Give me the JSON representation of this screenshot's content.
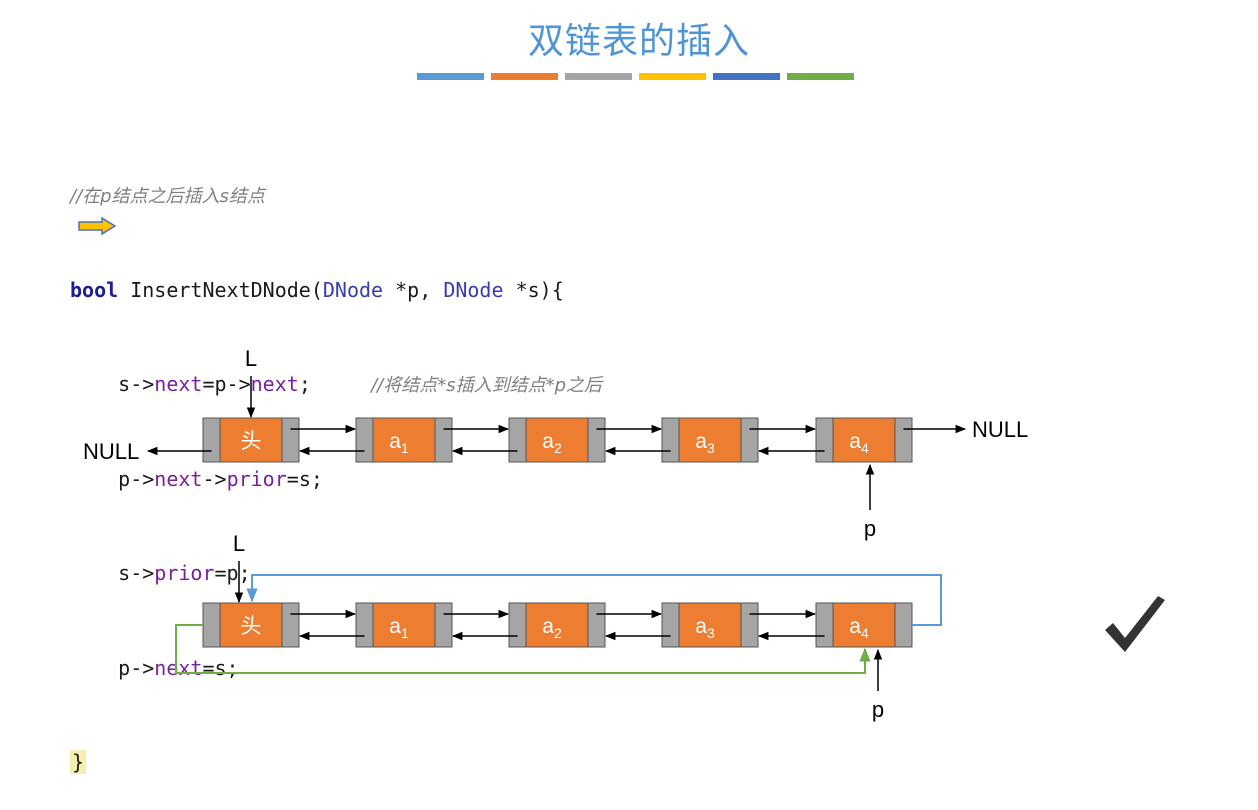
{
  "title": "双链表的插入",
  "colors": {
    "title": "#4f95d6",
    "bar": [
      "#5b9bd5",
      "#ed7d31",
      "#a5a5a5",
      "#ffc000",
      "#4472c4",
      "#70ad47"
    ],
    "node_fill": "#ed7d31",
    "node_ptr": "#a5a5a5",
    "loop_blue": "#5b9bd5",
    "loop_green": "#70ad47"
  },
  "code": {
    "comment": "//在p结点之后插入s结点",
    "signature_kw": "bool",
    "signature_fn": " InsertNextDNode(",
    "signature_t1": "DNode",
    "signature_p1": " *p, ",
    "signature_t2": "DNode",
    "signature_p2": " *s){",
    "l1_a": "    s->",
    "l1_f1": "next",
    "l1_b": "=p->",
    "l1_f2": "next",
    "l1_c": ";     ",
    "l1_comment": "//将结点*s插入到结点*p之后",
    "l2_a": "    p->",
    "l2_f1": "next",
    "l2_b": "->",
    "l2_f2": "prior",
    "l2_c": "=s;",
    "l3_a": "    s->",
    "l3_f1": "prior",
    "l3_c": "=p;",
    "l4_a": "    p->",
    "l4_f1": "next",
    "l4_c": "=s;",
    "close": "}"
  },
  "diagram": {
    "list1": {
      "head_label": "L",
      "nodes": [
        "头",
        "a",
        "a",
        "a",
        "a"
      ],
      "subscripts": [
        "",
        "1",
        "2",
        "3",
        "4"
      ],
      "left_null": "NULL",
      "right_null": "NULL",
      "pointer_label": "p"
    },
    "list2": {
      "head_label": "L",
      "nodes": [
        "头",
        "a",
        "a",
        "a",
        "a"
      ],
      "subscripts": [
        "",
        "1",
        "2",
        "3",
        "4"
      ],
      "pointer_label": "p"
    }
  },
  "icons": {
    "current_line": "right-arrow-icon",
    "result": "check-mark-icon"
  }
}
